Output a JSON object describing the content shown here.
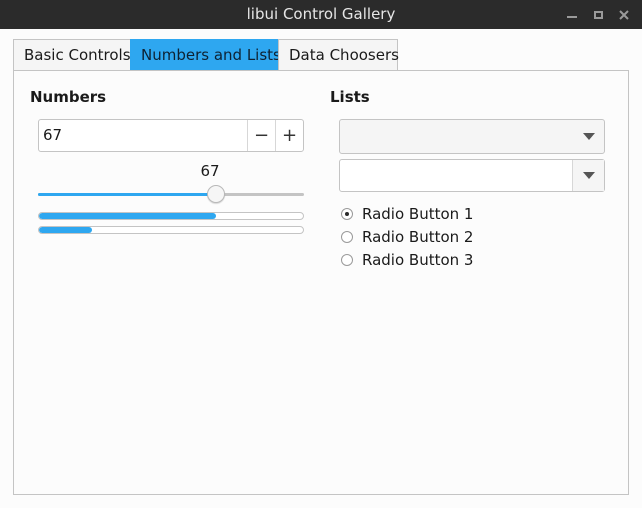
{
  "window": {
    "title": "libui Control Gallery",
    "controls": {
      "minimize_icon": "minimize-icon",
      "maximize_icon": "maximize-icon",
      "close_icon": "close-icon"
    }
  },
  "tabs": [
    {
      "label": "Basic Controls",
      "active": false
    },
    {
      "label": "Numbers and Lists",
      "active": true
    },
    {
      "label": "Data Choosers",
      "active": false
    }
  ],
  "numbers": {
    "title": "Numbers",
    "spinbox": {
      "value": "67",
      "decrement_glyph": "−",
      "increment_glyph": "+"
    },
    "slider": {
      "value_label": "67",
      "value": 67,
      "min": 0,
      "max": 100
    },
    "progress_bars": [
      {
        "value": 67,
        "max": 100
      },
      {
        "value": 20,
        "max": 100
      }
    ]
  },
  "lists": {
    "title": "Lists",
    "combobox": {
      "selected": ""
    },
    "editable_combobox": {
      "value": ""
    },
    "radio_buttons": [
      {
        "label": "Radio Button 1",
        "checked": true
      },
      {
        "label": "Radio Button 2",
        "checked": false
      },
      {
        "label": "Radio Button 3",
        "checked": false
      }
    ]
  },
  "colors": {
    "accent": "#2ea7f0",
    "titlebar": "#2b2b2b"
  }
}
